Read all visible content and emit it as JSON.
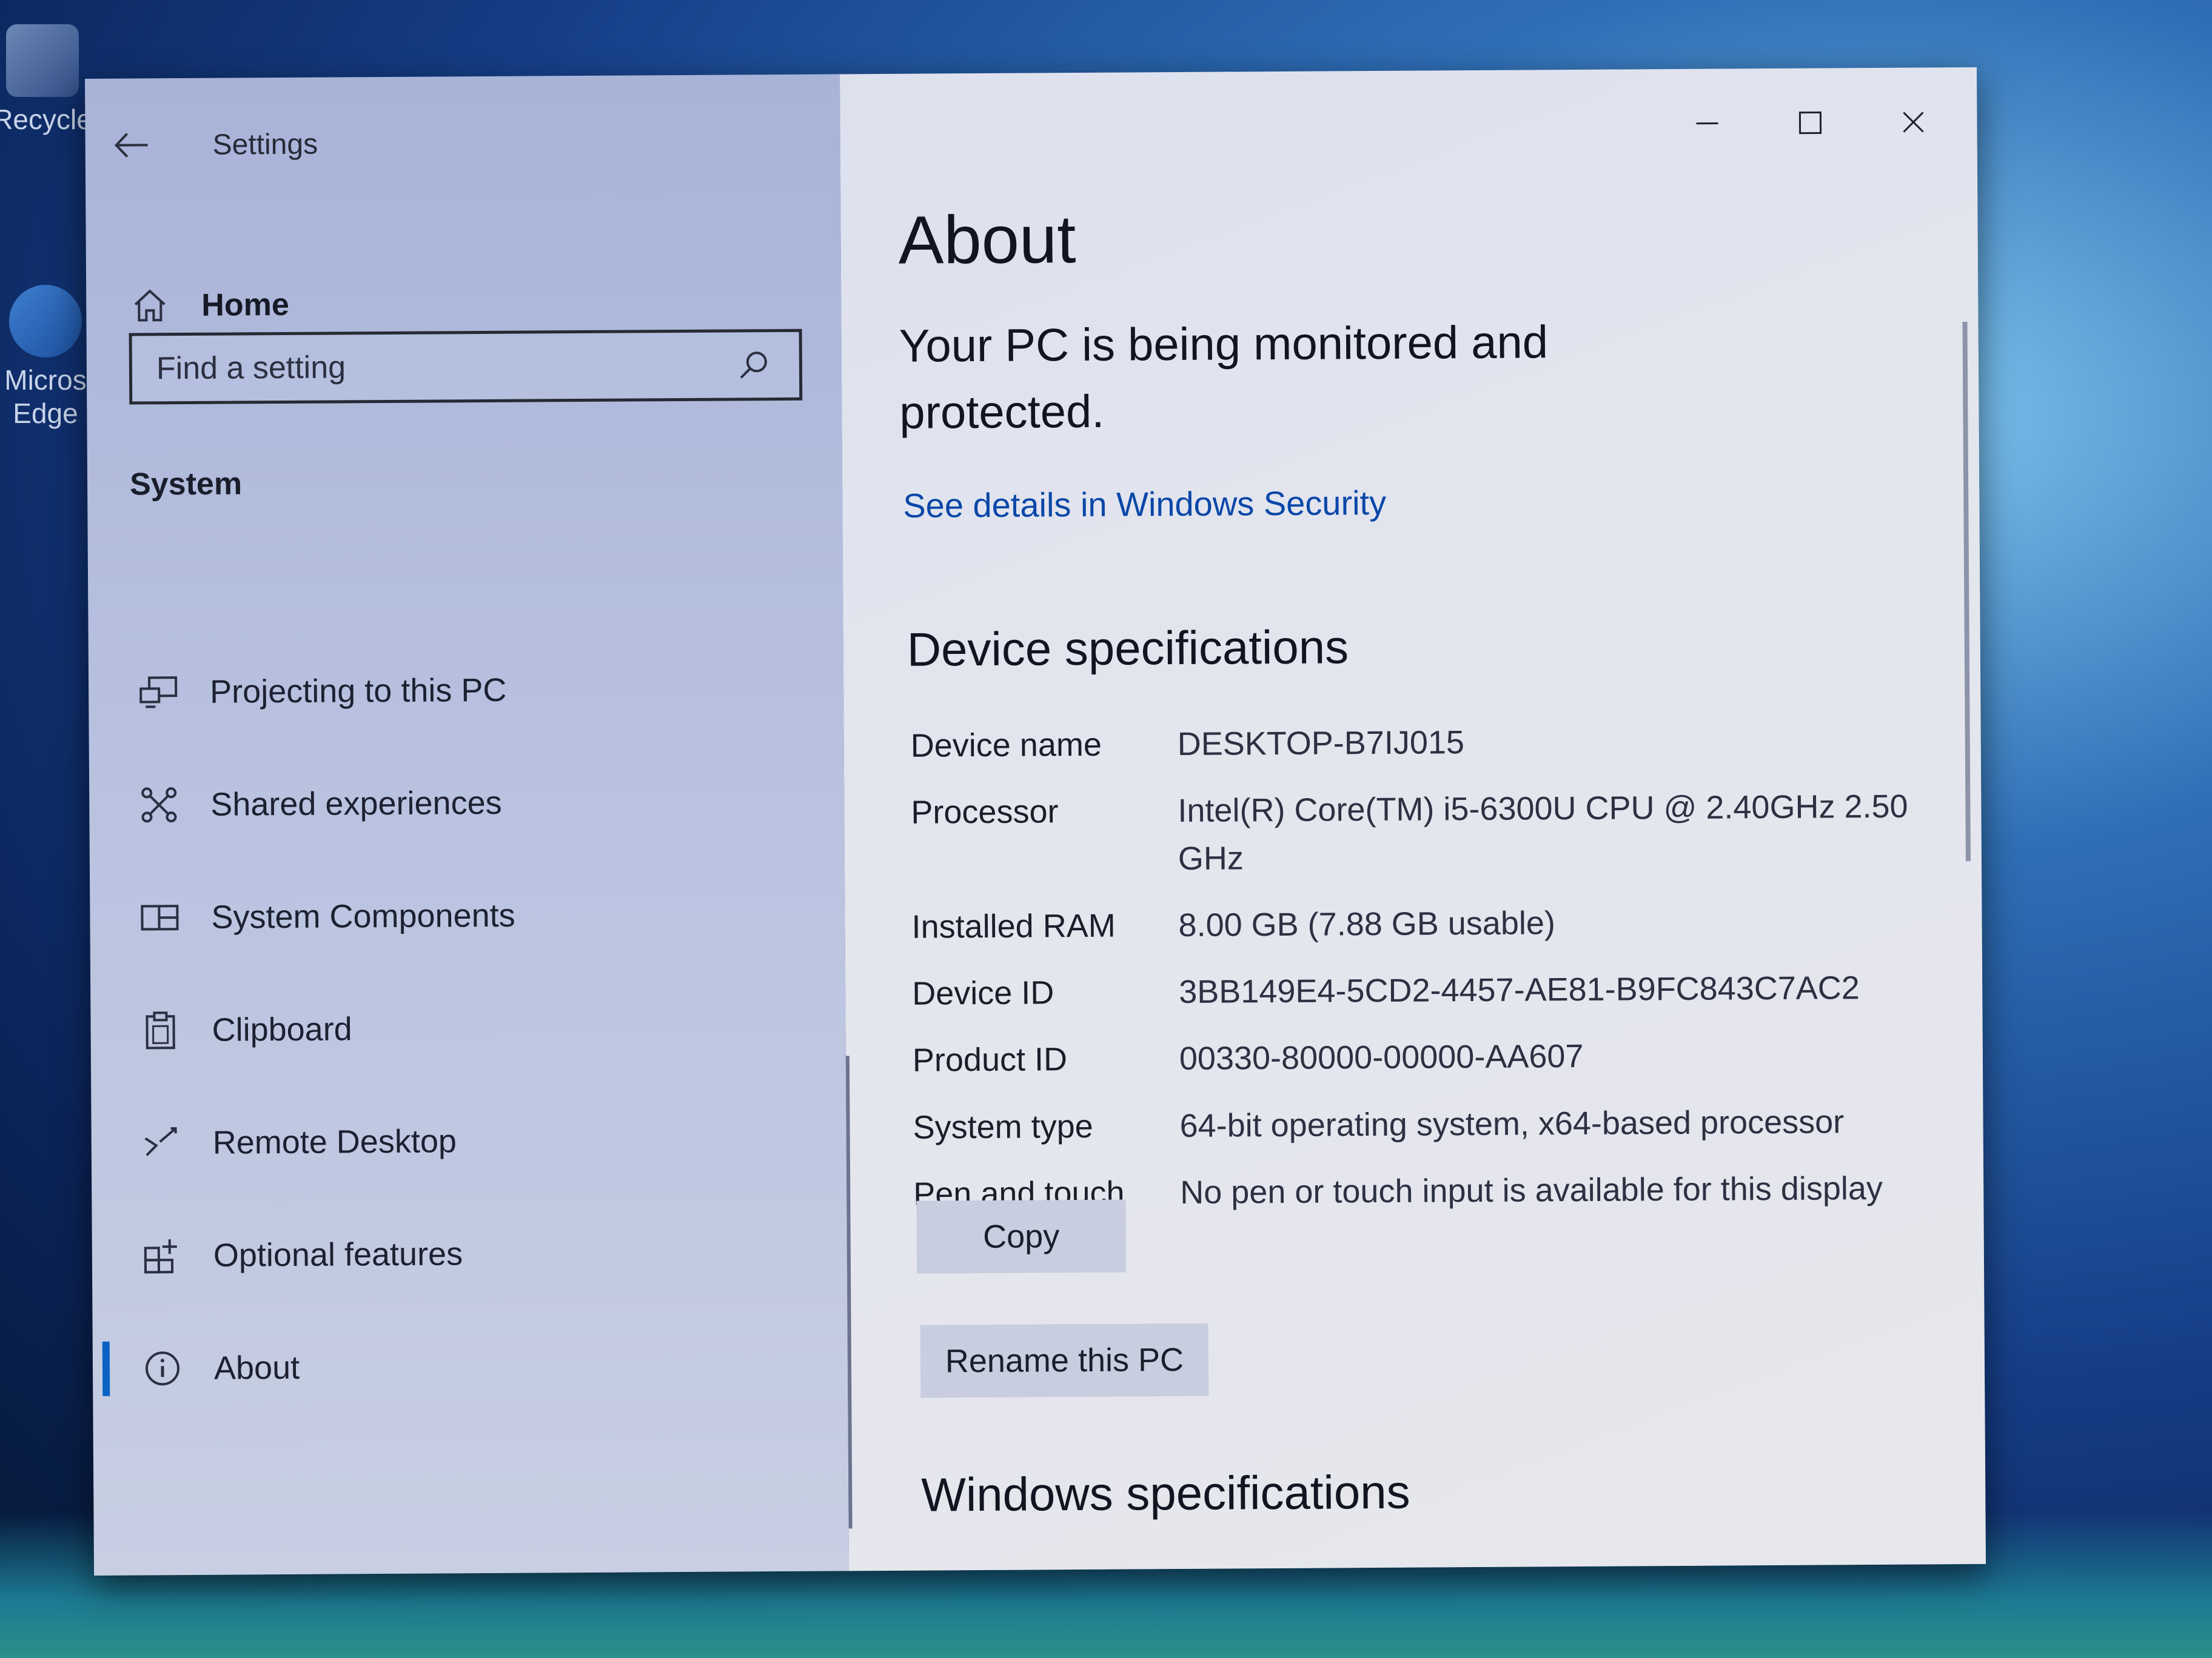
{
  "desktop": {
    "icons": [
      {
        "label": "Recycle"
      },
      {
        "label": "Micros Edge"
      }
    ]
  },
  "window": {
    "title": "Settings"
  },
  "sidebar": {
    "home_label": "Home",
    "search_placeholder": "Find a setting",
    "section": "System",
    "items": [
      {
        "label": "Projecting to this PC",
        "icon": "projector-icon"
      },
      {
        "label": "Shared experiences",
        "icon": "shared-experiences-icon"
      },
      {
        "label": "System Components",
        "icon": "system-components-icon"
      },
      {
        "label": "Clipboard",
        "icon": "clipboard-icon"
      },
      {
        "label": "Remote Desktop",
        "icon": "remote-desktop-icon"
      },
      {
        "label": "Optional features",
        "icon": "optional-features-icon"
      },
      {
        "label": "About",
        "icon": "info-icon",
        "selected": true
      }
    ]
  },
  "about": {
    "heading": "About",
    "monitor_text": "Your PC is being monitored and protected.",
    "security_link": "See details in Windows Security",
    "device_heading": "Device specifications",
    "specs": [
      {
        "label": "Device name",
        "value": "DESKTOP-B7IJ015"
      },
      {
        "label": "Processor",
        "value": "Intel(R) Core(TM) i5-6300U CPU @ 2.40GHz   2.50 GHz"
      },
      {
        "label": "Installed RAM",
        "value": "8.00 GB (7.88 GB usable)"
      },
      {
        "label": "Device ID",
        "value": "3BB149E4-5CD2-4457-AE81-B9FC843C7AC2"
      },
      {
        "label": "Product ID",
        "value": "00330-80000-00000-AA607"
      },
      {
        "label": "System type",
        "value": "64-bit operating system, x64-based processor"
      },
      {
        "label": "Pen and touch",
        "value": "No pen or touch input is available for this display"
      }
    ],
    "copy_label": "Copy",
    "rename_label": "Rename this PC",
    "windows_heading": "Windows specifications"
  }
}
